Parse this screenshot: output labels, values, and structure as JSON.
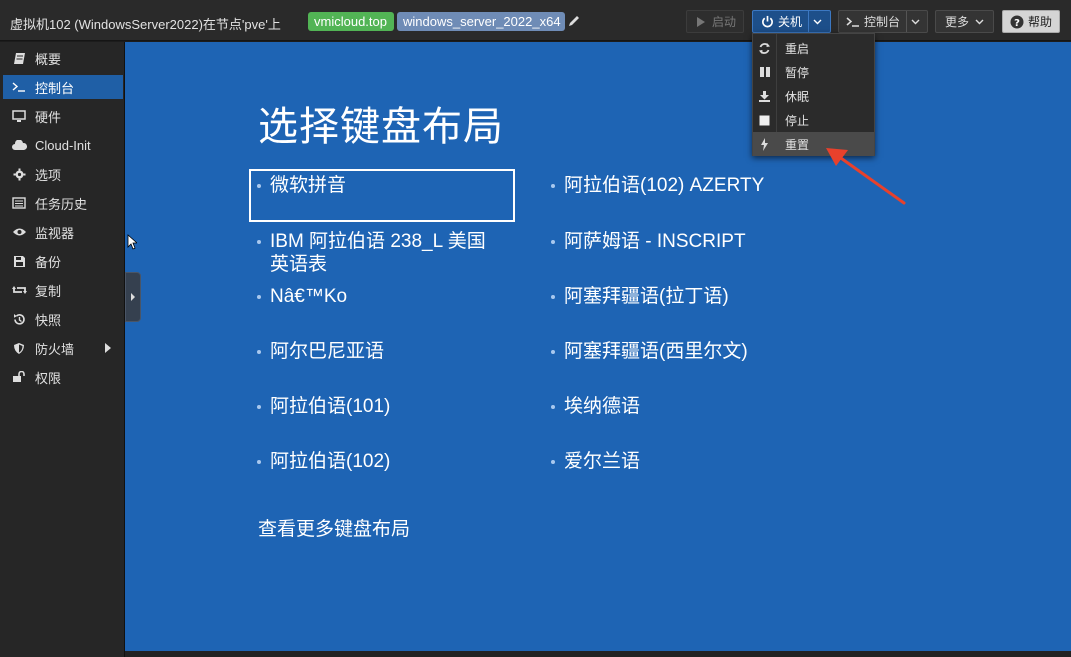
{
  "header": {
    "vm_title": "虚拟机102 (WindowsServer2022)在节点'pve'上",
    "tags": [
      "vmicloud.top",
      "windows_server_2022_x64"
    ],
    "buttons": {
      "start": "启动",
      "shutdown": "关机",
      "console": "控制台",
      "more": "更多",
      "help": "帮助"
    }
  },
  "sidebar": {
    "items": [
      {
        "label": "概要",
        "icon": "book-icon"
      },
      {
        "label": "控制台",
        "icon": "terminal-icon",
        "active": true
      },
      {
        "label": "硬件",
        "icon": "monitor-icon"
      },
      {
        "label": "Cloud-Init",
        "icon": "cloud-icon"
      },
      {
        "label": "选项",
        "icon": "gear-icon"
      },
      {
        "label": "任务历史",
        "icon": "list-icon"
      },
      {
        "label": "监视器",
        "icon": "eye-icon"
      },
      {
        "label": "备份",
        "icon": "floppy-icon"
      },
      {
        "label": "复制",
        "icon": "retweet-icon"
      },
      {
        "label": "快照",
        "icon": "history-icon"
      },
      {
        "label": "防火墙",
        "icon": "shield-icon",
        "has_submenu": true
      },
      {
        "label": "权限",
        "icon": "unlock-icon"
      }
    ]
  },
  "console": {
    "title": "选择键盘布局",
    "left_options": [
      "微软拼音",
      "IBM 阿拉伯语 238_L 美国英语表",
      "Nâ€™Ko",
      "阿尔巴尼亚语",
      "阿拉伯语(101)",
      "阿拉伯语(102)"
    ],
    "left_option_ibm_line1": "IBM 阿拉伯语 238_L 美国",
    "left_option_ibm_line2": "英语表",
    "right_options": [
      "阿拉伯语(102) AZERTY",
      "阿萨姆语 - INSCRIPT",
      "阿塞拜疆语(拉丁语)",
      "阿塞拜疆语(西里尔文)",
      "埃纳德语",
      "爱尔兰语"
    ],
    "more_link": "查看更多键盘布局",
    "selected_index": 0,
    "background_color": "#1e64b4"
  },
  "shutdown_menu": {
    "items": [
      {
        "label": "重启",
        "icon": "refresh-icon"
      },
      {
        "label": "暂停",
        "icon": "pause-icon"
      },
      {
        "label": "休眠",
        "icon": "download-icon"
      },
      {
        "label": "停止",
        "icon": "stop-icon"
      },
      {
        "label": "重置",
        "icon": "bolt-icon",
        "hover": true
      }
    ]
  },
  "colors": {
    "accent": "#1f5fa6",
    "tag_green": "#52b455",
    "tag_blue": "#6f8cb6",
    "annotation_arrow": "#e8412c"
  }
}
